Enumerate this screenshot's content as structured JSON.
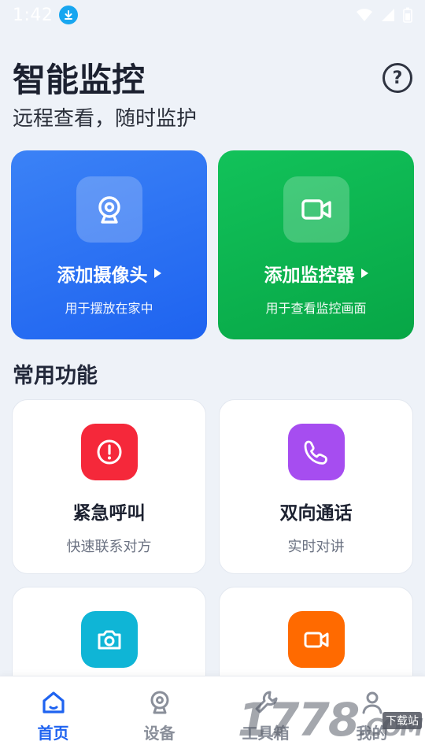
{
  "status_bar": {
    "time": "1:42"
  },
  "header": {
    "title": "智能监控",
    "subtitle": "远程查看，随时监护",
    "help_symbol": "?"
  },
  "hero_cards": [
    {
      "title": "添加摄像头",
      "subtitle": "用于摆放在家中",
      "icon": "webcam-icon",
      "color": "#2b72f4"
    },
    {
      "title": "添加监控器",
      "subtitle": "用于查看监控画面",
      "icon": "video-camera-icon",
      "color": "#0bb350"
    }
  ],
  "section": {
    "title": "常用功能"
  },
  "features": [
    {
      "title": "紧急呼叫",
      "subtitle": "快速联系对方",
      "icon": "alert-circle-icon",
      "color": "#f5283a"
    },
    {
      "title": "双向通话",
      "subtitle": "实时对讲",
      "icon": "phone-icon",
      "color": "#a64df0"
    },
    {
      "title": "",
      "subtitle": "",
      "icon": "camera-icon",
      "color": "#0fb5d6"
    },
    {
      "title": "",
      "subtitle": "",
      "icon": "video-camera-icon",
      "color": "#ff6a00"
    }
  ],
  "bottom_nav": [
    {
      "label": "首页",
      "icon": "home-icon",
      "active": true
    },
    {
      "label": "设备",
      "icon": "webcam-icon",
      "active": false
    },
    {
      "label": "工具箱",
      "icon": "wrench-icon",
      "active": false
    },
    {
      "label": "我的",
      "icon": "person-icon",
      "active": false
    }
  ],
  "watermark": {
    "text": "1778",
    "suffix": ".COM",
    "tag": "下载站"
  },
  "colors": {
    "active_nav": "#1f63f0",
    "inactive_nav": "#8a8f9a",
    "background": "#eef2f8"
  }
}
